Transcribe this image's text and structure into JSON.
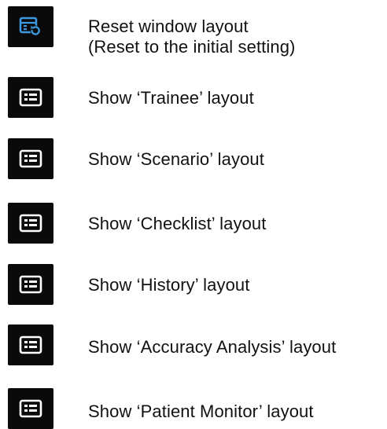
{
  "colors": {
    "icon_background": "#0a0a0a",
    "icon_glyph": "#ffffff",
    "reset_icon_accent": "#3b9be0",
    "text": "#111111"
  },
  "items": [
    {
      "icon": "reset-layout-icon",
      "label_line1": "Reset window layout",
      "label_line2": "(Reset to the initial setting)"
    },
    {
      "icon": "layout-list-icon",
      "label": "Show ‘Trainee’ layout"
    },
    {
      "icon": "layout-list-icon",
      "label": "Show ‘Scenario’ layout"
    },
    {
      "icon": "layout-list-icon",
      "label": "Show ‘Checklist’ layout"
    },
    {
      "icon": "layout-list-icon",
      "label": "Show ‘History’ layout"
    },
    {
      "icon": "layout-list-icon",
      "label": "Show ‘Accuracy Analysis’ layout"
    },
    {
      "icon": "layout-list-icon",
      "label": "Show ‘Patient Monitor’ layout"
    }
  ]
}
